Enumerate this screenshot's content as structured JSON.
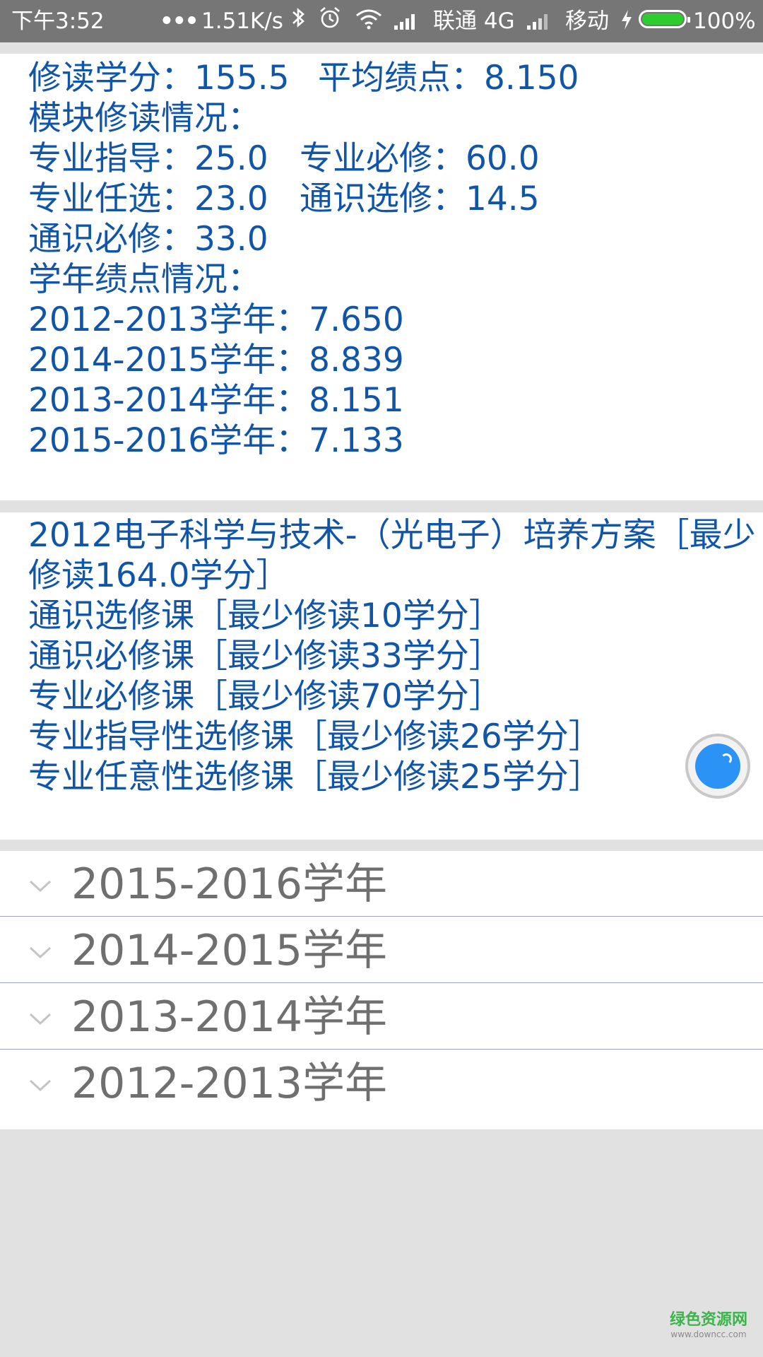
{
  "status_bar": {
    "time": "下午3:52",
    "dots": "•••",
    "net_speed": "1.51K/s",
    "carrier1": "联通 4G",
    "carrier2": "移动",
    "battery_pct": "100%",
    "battery_level": 1.0
  },
  "summary": {
    "credits_label": "修读学分：155.5",
    "gpa_label": "平均绩点：8.150",
    "module_heading": "模块修读情况：",
    "modules": [
      "专业指导：25.0",
      "专业必修：60.0",
      "专业任选：23.0",
      "通识选修：14.5",
      "通识必修：33.0"
    ],
    "year_gpa_heading": "学年绩点情况：",
    "year_gpas": [
      "2012-2013学年：7.650",
      "2014-2015学年：8.839",
      "2013-2014学年：8.151",
      "2015-2016学年：7.133"
    ]
  },
  "plan": {
    "title": "2012电子科学与技术-（光电子）培养方案［最少修读164.0学分］",
    "items": [
      "通识选修课［最少修读10学分］",
      "通识必修课［最少修读33学分］",
      "专业必修课［最少修读70学分］",
      "专业指导性选修课［最少修读26学分］",
      "专业任意性选修课［最少修读25学分］"
    ]
  },
  "years": [
    "2015-2016学年",
    "2014-2015学年",
    "2013-2014学年",
    "2012-2013学年"
  ],
  "watermark": {
    "line1": "绿色资源网",
    "line2": "www.downcc.com"
  },
  "colors": {
    "text_blue": "#1155a8",
    "year_gray": "#6f6f6f",
    "fab_blue": "#2b93f5",
    "battery_green": "#2ecc2e"
  }
}
